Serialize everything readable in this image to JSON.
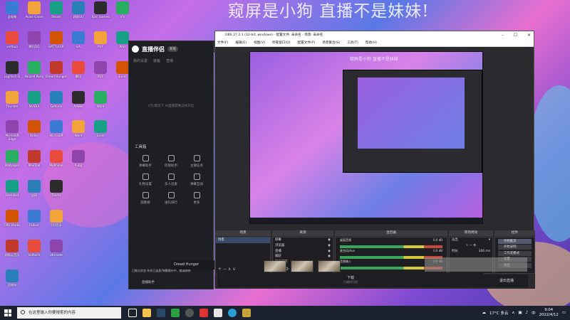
{
  "wallpaper": {
    "watermark_text": "窥屏是小狗 直播不是妹妹!"
  },
  "desktop": {
    "col1": [
      "此电脑",
      "vsrtKuo",
      "Logitech G",
      "Thunder",
      "Microsoft Edge",
      "Wallpaper",
      "Loveliest",
      "OBS Studio",
      "网易云音乐",
      "回收站"
    ],
    "col2": [
      "Avast Game",
      "腾讯QQ",
      "Paused Party",
      "NVIDIA",
      "Uplay",
      "MaxTool",
      "战网",
      "Fallout",
      "Valheim"
    ],
    "col3": [
      "Steam",
      "BATTLEGR",
      "Dread Hunger",
      "Geforce",
      "Microsoft",
      "MyPhone",
      "Teams",
      "QQ音乐",
      "Ultimate"
    ],
    "col4": [
      "网易UU",
      "EA",
      "腾讯",
      "Adobe",
      "Word",
      "Pubg"
    ],
    "col5": [
      "Epic Games",
      "PDF",
      "PDF",
      "Word",
      "Excel"
    ],
    "col6": [
      "Vfx",
      "Wps",
      "Excel"
    ]
  },
  "helper": {
    "nav_label": "商店",
    "logo": "直播伴侣",
    "version": "新版",
    "tabs": [
      "我的设置",
      "装备",
      "直播"
    ],
    "hint": "0元/最近下 AI直播需要这样开启",
    "tools_title": "工具箱",
    "tools": [
      "弹幕助手",
      "房管助手",
      "主播任务",
      "礼物设置",
      "多人连麦",
      "弹幕互动",
      "观看榜",
      "送礼排行",
      "更多"
    ],
    "footer": "已推出状态 伙伴已连麦/弹幕操作中，敬请期待",
    "bottom_label": "直播助手"
  },
  "game_bar": {
    "title": "Dread Hunger",
    "second": ""
  },
  "obs": {
    "title": "OBS 27.2.1 (32-bit, windows) - 配置文件: 未命名 - 场景: 未命名",
    "menu": [
      "文件(F)",
      "编辑(E)",
      "视图(V)",
      "停靠窗口(D)",
      "配置文件(P)",
      "场景集合(S)",
      "工具(T)",
      "帮助(H)"
    ],
    "preview_watermark": "窥屏是小狗 直播不是妹妹",
    "docks": {
      "scenes": "场景",
      "sources": "来源",
      "mixer": "混音器",
      "transitions": "转场特效",
      "controls": "控件"
    },
    "scenes": [
      "场景"
    ],
    "sources": [
      "屏幕",
      "浏览器",
      "直播",
      "捕获",
      "游戏捕获"
    ],
    "mixer": [
      {
        "label": "桌面音频",
        "db": "0.0 dB"
      },
      {
        "label": "麦克风/Aux",
        "db": "0.0 dB"
      },
      {
        "label": "音频输入",
        "db": "0.0 dB"
      }
    ],
    "transition": {
      "type": "淡出",
      "duration_label": "时长",
      "duration": "300 ms"
    },
    "controls": [
      "开始推流",
      "开始录制",
      "工作室模式",
      "设置",
      "退出"
    ],
    "status": {
      "live": "LIVE: 00:00:00",
      "rec": "REC: 00:00:00",
      "cpu": "CPU: 5.6%, 30.00 fps"
    }
  },
  "bottom": {
    "title": "下载",
    "subtitle": "已随时可用",
    "right_label": "退出直播"
  },
  "taskbar": {
    "search_placeholder": "在这里输入你要搜索的内容",
    "weather": "17°C 多云",
    "time": "9:04",
    "date": "2022/4/12"
  }
}
